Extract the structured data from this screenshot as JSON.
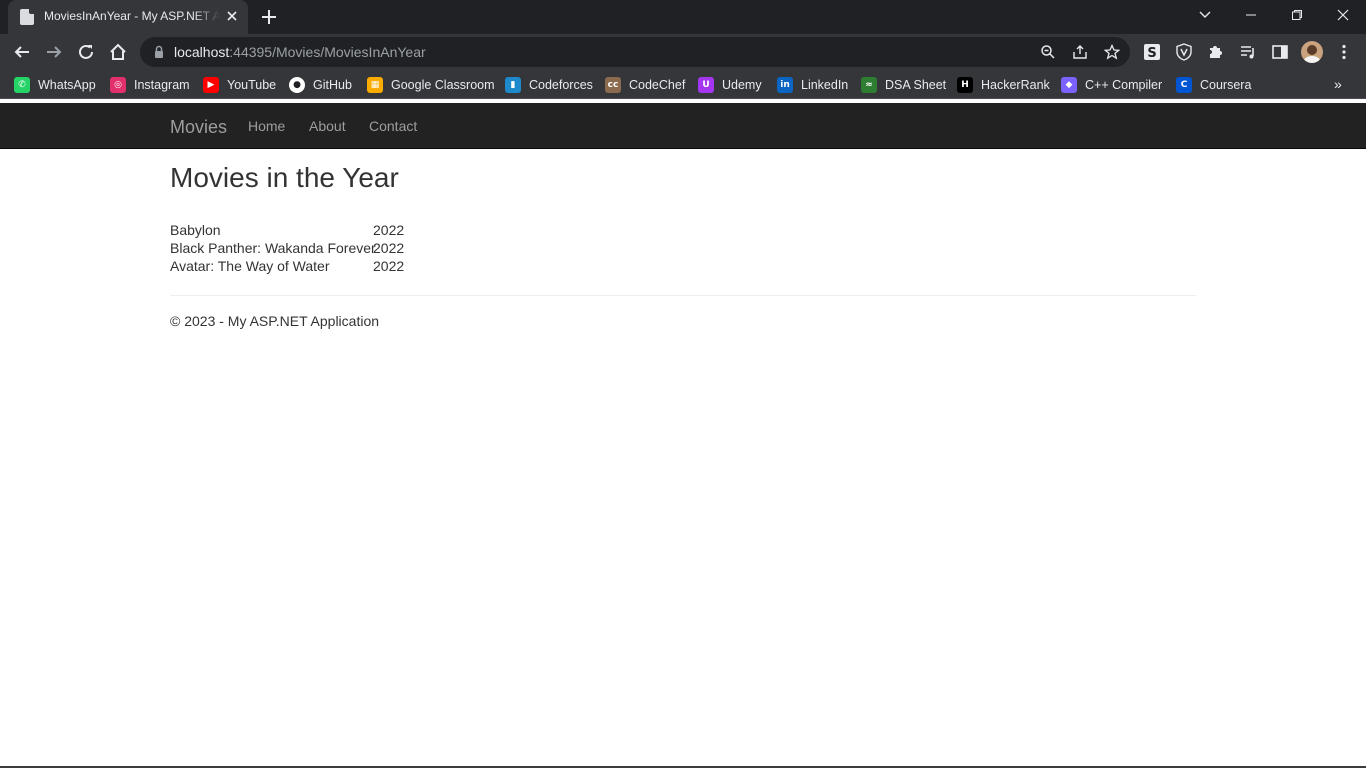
{
  "browser": {
    "tab_title": "MoviesInAnYear - My ASP.NET Application",
    "url_host": "localhost",
    "url_rest": ":44395/Movies/MoviesInAnYear",
    "accent": "#202124"
  },
  "bookmarks": [
    {
      "label": "WhatsApp",
      "icon": "whatsapp-icon",
      "color": "#25d366"
    },
    {
      "label": "Instagram",
      "icon": "instagram-icon",
      "color": "#e1306c"
    },
    {
      "label": "YouTube",
      "icon": "youtube-icon",
      "color": "#ff0000"
    },
    {
      "label": "GitHub",
      "icon": "github-icon",
      "color": "#ffffff"
    },
    {
      "label": "Google Classroom",
      "icon": "classroom-icon",
      "color": "#f9ab00"
    },
    {
      "label": "Codeforces",
      "icon": "codeforces-icon",
      "color": "#1f8acb"
    },
    {
      "label": "CodeChef",
      "icon": "codechef-icon",
      "color": "#8b6a4e"
    },
    {
      "label": "Udemy",
      "icon": "udemy-icon",
      "color": "#a435f0"
    },
    {
      "label": "LinkedIn",
      "icon": "linkedin-icon",
      "color": "#0a66c2"
    },
    {
      "label": "DSA Sheet",
      "icon": "dsa-sheet-icon",
      "color": "#2e7d32"
    },
    {
      "label": "HackerRank",
      "icon": "hackerrank-icon",
      "color": "#000000"
    },
    {
      "label": "C++ Compiler",
      "icon": "compiler-icon",
      "color": "#7b61ff"
    },
    {
      "label": "Coursera",
      "icon": "coursera-icon",
      "color": "#0056d2"
    }
  ],
  "site": {
    "brand": "Movies",
    "nav": [
      "Home",
      "About",
      "Contact"
    ],
    "navbar_color": "#222222"
  },
  "main": {
    "title": "Movies in the Year",
    "movies": [
      {
        "name": "Babylon",
        "year": "2022"
      },
      {
        "name": "Black Panther: Wakanda Forever",
        "year": "2022"
      },
      {
        "name": "Avatar: The Way of Water",
        "year": "2022"
      }
    ]
  },
  "footer": {
    "text": "© 2023 - My ASP.NET Application"
  }
}
